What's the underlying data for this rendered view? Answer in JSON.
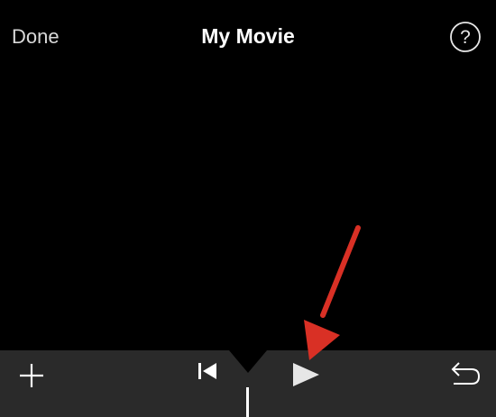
{
  "navbar": {
    "done_label": "Done",
    "title": "My Movie",
    "help_label": "?"
  },
  "toolbar": {
    "add_icon": "plus-icon",
    "rewind_icon": "skip-to-start-icon",
    "play_icon": "play-icon",
    "undo_icon": "undo-icon"
  },
  "colors": {
    "background": "#000000",
    "toolbar": "#2a2a2a",
    "annotation_arrow": "#d93025"
  }
}
